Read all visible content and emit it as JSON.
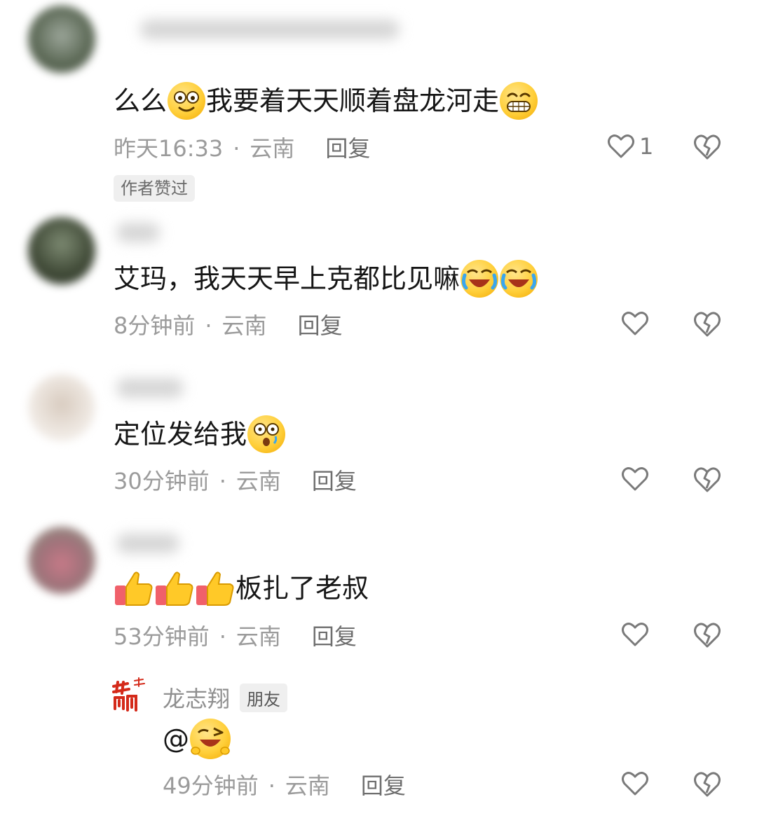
{
  "comments": [
    {
      "text": "么么",
      "text2": "我要着天天顺着盘龙河走",
      "time": "昨天16:33",
      "location": "云南",
      "reply_label": "回复",
      "like_count": "1",
      "author_tag": "作者赞过"
    },
    {
      "text": "艾玛，我天天早上克都比见嘛",
      "time": "8分钟前",
      "location": "云南",
      "reply_label": "回复"
    },
    {
      "text": "定位发给我",
      "time": "30分钟前",
      "location": "云南",
      "reply_label": "回复"
    },
    {
      "text": "板扎了老叔",
      "time": "53分钟前",
      "location": "云南",
      "reply_label": "回复"
    }
  ],
  "reply": {
    "name": "龙志翔",
    "badge": "朋友",
    "text": "@",
    "time": "49分钟前",
    "location": "云南",
    "reply_label": "回复"
  },
  "separator": "·",
  "colors": {
    "meta": "#9b9b9b",
    "emoji": "#ffcf3a",
    "logo": "#d42a1a"
  },
  "icons": [
    "heart-outline-icon",
    "broken-heart-icon",
    "smile-emoji-icon",
    "grin-emoji-icon",
    "laugh-cry-emoji-icon",
    "surprised-emoji-icon",
    "thumbs-up-emoji-icon",
    "wink-emoji-icon"
  ]
}
